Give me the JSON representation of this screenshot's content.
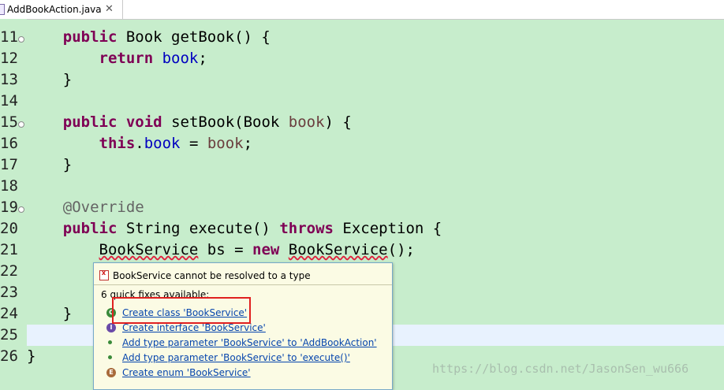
{
  "editor": {
    "tab": {
      "title": "AddBookAction.java",
      "close_glyph": "✕"
    },
    "lines": [
      {
        "num": "11",
        "parts": [
          {
            "t": "    "
          },
          {
            "t": "public",
            "c": "kw"
          },
          {
            "t": " Book getBook() {"
          }
        ]
      },
      {
        "num": "12",
        "parts": [
          {
            "t": "        "
          },
          {
            "t": "return",
            "c": "kw"
          },
          {
            "t": " "
          },
          {
            "t": "book",
            "c": "fld"
          },
          {
            "t": ";"
          }
        ]
      },
      {
        "num": "13",
        "parts": [
          {
            "t": "    }"
          }
        ]
      },
      {
        "num": "14",
        "parts": []
      },
      {
        "num": "15",
        "parts": [
          {
            "t": "    "
          },
          {
            "t": "public",
            "c": "kw"
          },
          {
            "t": " "
          },
          {
            "t": "void",
            "c": "kw"
          },
          {
            "t": " setBook(Book "
          },
          {
            "t": "book",
            "c": "par"
          },
          {
            "t": ") {"
          }
        ]
      },
      {
        "num": "16",
        "parts": [
          {
            "t": "        "
          },
          {
            "t": "this",
            "c": "kw"
          },
          {
            "t": "."
          },
          {
            "t": "book",
            "c": "fld"
          },
          {
            "t": " = "
          },
          {
            "t": "book",
            "c": "par"
          },
          {
            "t": ";"
          }
        ]
      },
      {
        "num": "17",
        "parts": [
          {
            "t": "    }"
          }
        ]
      },
      {
        "num": "18",
        "parts": []
      },
      {
        "num": "19",
        "parts": [
          {
            "t": "    "
          },
          {
            "t": "@Override",
            "c": "ann"
          }
        ]
      },
      {
        "num": "20",
        "parts": [
          {
            "t": "    "
          },
          {
            "t": "public",
            "c": "kw"
          },
          {
            "t": " String execute() "
          },
          {
            "t": "throws",
            "c": "kw"
          },
          {
            "t": " Exception {"
          }
        ]
      },
      {
        "num": "21",
        "parts": [
          {
            "t": "        "
          },
          {
            "t": "BookService",
            "c": "err"
          },
          {
            "t": " bs = "
          },
          {
            "t": "new",
            "c": "kw"
          },
          {
            "t": " "
          },
          {
            "t": "BookService",
            "c": "err"
          },
          {
            "t": "();"
          }
        ]
      },
      {
        "num": "22",
        "parts": []
      },
      {
        "num": "23",
        "parts": []
      },
      {
        "num": "24",
        "parts": [
          {
            "t": "    }"
          }
        ]
      },
      {
        "num": "25",
        "parts": []
      },
      {
        "num": "26",
        "parts": [
          {
            "t": "}"
          }
        ]
      }
    ]
  },
  "quickfix": {
    "message": "BookService cannot be resolved to a type",
    "fixes_available": "6 quick fixes available:",
    "fixes": [
      {
        "label": "Create class 'BookService'",
        "icon": "class-icon",
        "glyph": "C",
        "color": "#3a8a3a",
        "small": false
      },
      {
        "label": "Create interface 'BookService'",
        "icon": "interface-icon",
        "glyph": "I",
        "color": "#6a4aa8",
        "small": false
      },
      {
        "label": "Add type parameter 'BookService' to 'AddBookAction'",
        "icon": "type-parameter-icon",
        "glyph": "",
        "color": "#3a8a3a",
        "small": true
      },
      {
        "label": "Add type parameter 'BookService' to 'execute()'",
        "icon": "type-parameter-icon",
        "glyph": "",
        "color": "#3a8a3a",
        "small": true
      },
      {
        "label": "Create enum 'BookService'",
        "icon": "enum-icon",
        "glyph": "E",
        "color": "#a86a3a",
        "small": false
      }
    ]
  },
  "watermark": "https://blog.csdn.net/JasonSen_wu666"
}
